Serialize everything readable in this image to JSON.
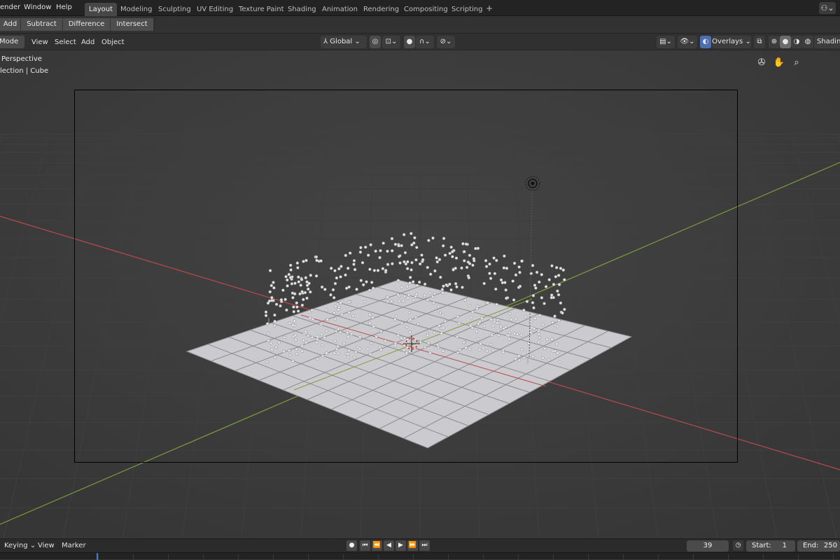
{
  "menu": [
    "ender",
    "Window",
    "Help"
  ],
  "workspace_tabs": [
    "Layout",
    "Modeling",
    "Sculpting",
    "UV Editing",
    "Texture Paint",
    "Shading",
    "Animation",
    "Rendering",
    "Compositing",
    "Scripting"
  ],
  "active_tab": "Layout",
  "tab_add": "+",
  "bool_buttons": [
    "Add",
    "Subtract",
    "Difference",
    "Intersect"
  ],
  "viewport_header": {
    "mode": "Mode",
    "menus": [
      "View",
      "Select",
      "Add",
      "Object"
    ],
    "transform_orientation": "Global",
    "overlays_label": "Overlays",
    "shading_label": "Shading"
  },
  "viewport_info": {
    "view_name": "Perspective",
    "collection": "lection | Cube"
  },
  "icons": {
    "account": "blender-account-icon",
    "camera_nav": "camera-icon",
    "pan_nav": "hand-icon",
    "zoom_nav": "zoom-icon"
  },
  "timeline": {
    "menus": [
      "Keying",
      "View",
      "Marker"
    ],
    "current_frame": "39",
    "start_label": "Start:",
    "start_value": "1",
    "end_label": "End:",
    "end_value": "250"
  },
  "colors": {
    "x_axis": "#b94a4a",
    "y_axis": "#7f9e3c",
    "accent_blue": "#4b6fb0",
    "plane": "#cbcbcf"
  }
}
